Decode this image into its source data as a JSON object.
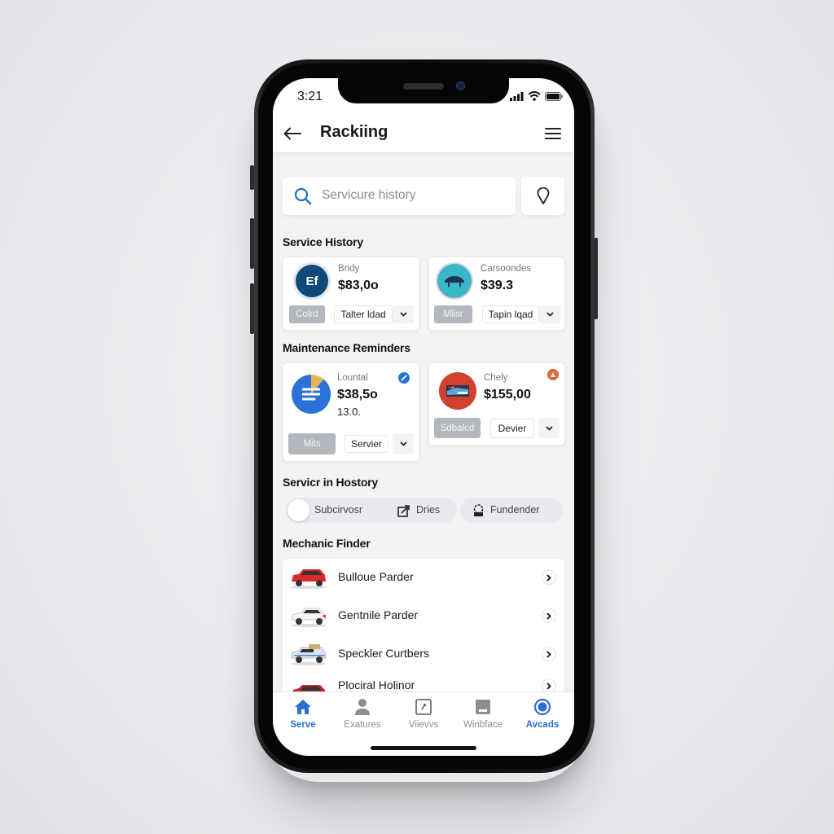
{
  "status_bar": {
    "time": "3:21"
  },
  "header": {
    "title": "Rackiing",
    "back_icon": "arrow-left-icon",
    "menu_icon": "hamburger-menu-icon"
  },
  "search": {
    "value": "Servicure history",
    "search_icon": "search-icon",
    "location_icon": "map-pin-icon"
  },
  "service_history": {
    "title": "Service History",
    "cards": [
      {
        "label": "Bndy",
        "price": "$83,0o",
        "tag": "Colrd",
        "select": "Talter ldad",
        "avatar_text": "Ef",
        "avatar_color": "#0f4a78"
      },
      {
        "label": "Carsoondes",
        "price": "$39.3",
        "tag": "Mlisr",
        "select": "Tapin lqad",
        "avatar_color": "#3ab6c8"
      }
    ]
  },
  "maintenance_reminders": {
    "title": "Maintenance Reminders",
    "cards": [
      {
        "label": "Lountal",
        "price": "$38,5o",
        "sub": "13.0.",
        "tag": "Mits",
        "select": "Servier",
        "avatar_color": "#2a72d6",
        "badge_color": "#2a72d6",
        "badge_icon": "edit-icon"
      },
      {
        "label": "Chely",
        "price": "$155,00",
        "tag": "Sdbalcd",
        "select": "Devier",
        "avatar_color": "#d4402e",
        "badge_color": "#e0683c",
        "badge_icon": "alert-icon"
      }
    ]
  },
  "service_in_history": {
    "title": "Servicr in Hostory",
    "pills": [
      {
        "label": "Subcirvosr",
        "icon": "toggle-knob-icon"
      },
      {
        "label": "Dries",
        "icon": "export-icon"
      },
      {
        "label": "Fundender",
        "icon": "gear-car-icon"
      }
    ]
  },
  "mechanic_finder": {
    "title": "Mechanic Finder",
    "items": [
      {
        "name": "Bulloue Parder",
        "car_color": "#d8292c"
      },
      {
        "name": "Gentnile Parder",
        "car_color": "#f2f2f2"
      },
      {
        "name": "Speckler Curtbers",
        "car_color": "#dfe6ee"
      },
      {
        "name": "Plociral Holinor",
        "car_color": "#c6262c"
      }
    ]
  },
  "tab_bar": {
    "tabs": [
      {
        "label": "Serve",
        "icon": "home-icon",
        "active": true
      },
      {
        "label": "Exatures",
        "icon": "user-icon",
        "active": false
      },
      {
        "label": "Viievvs",
        "icon": "views-icon",
        "active": false
      },
      {
        "label": "Winbface",
        "icon": "inbox-icon",
        "active": false
      },
      {
        "label": "Avcads",
        "icon": "circle-target-icon",
        "active": true
      }
    ]
  },
  "colors": {
    "accent": "#2b6fd0",
    "background": "#f2f3f5",
    "tag_gray": "#b4b8be"
  }
}
